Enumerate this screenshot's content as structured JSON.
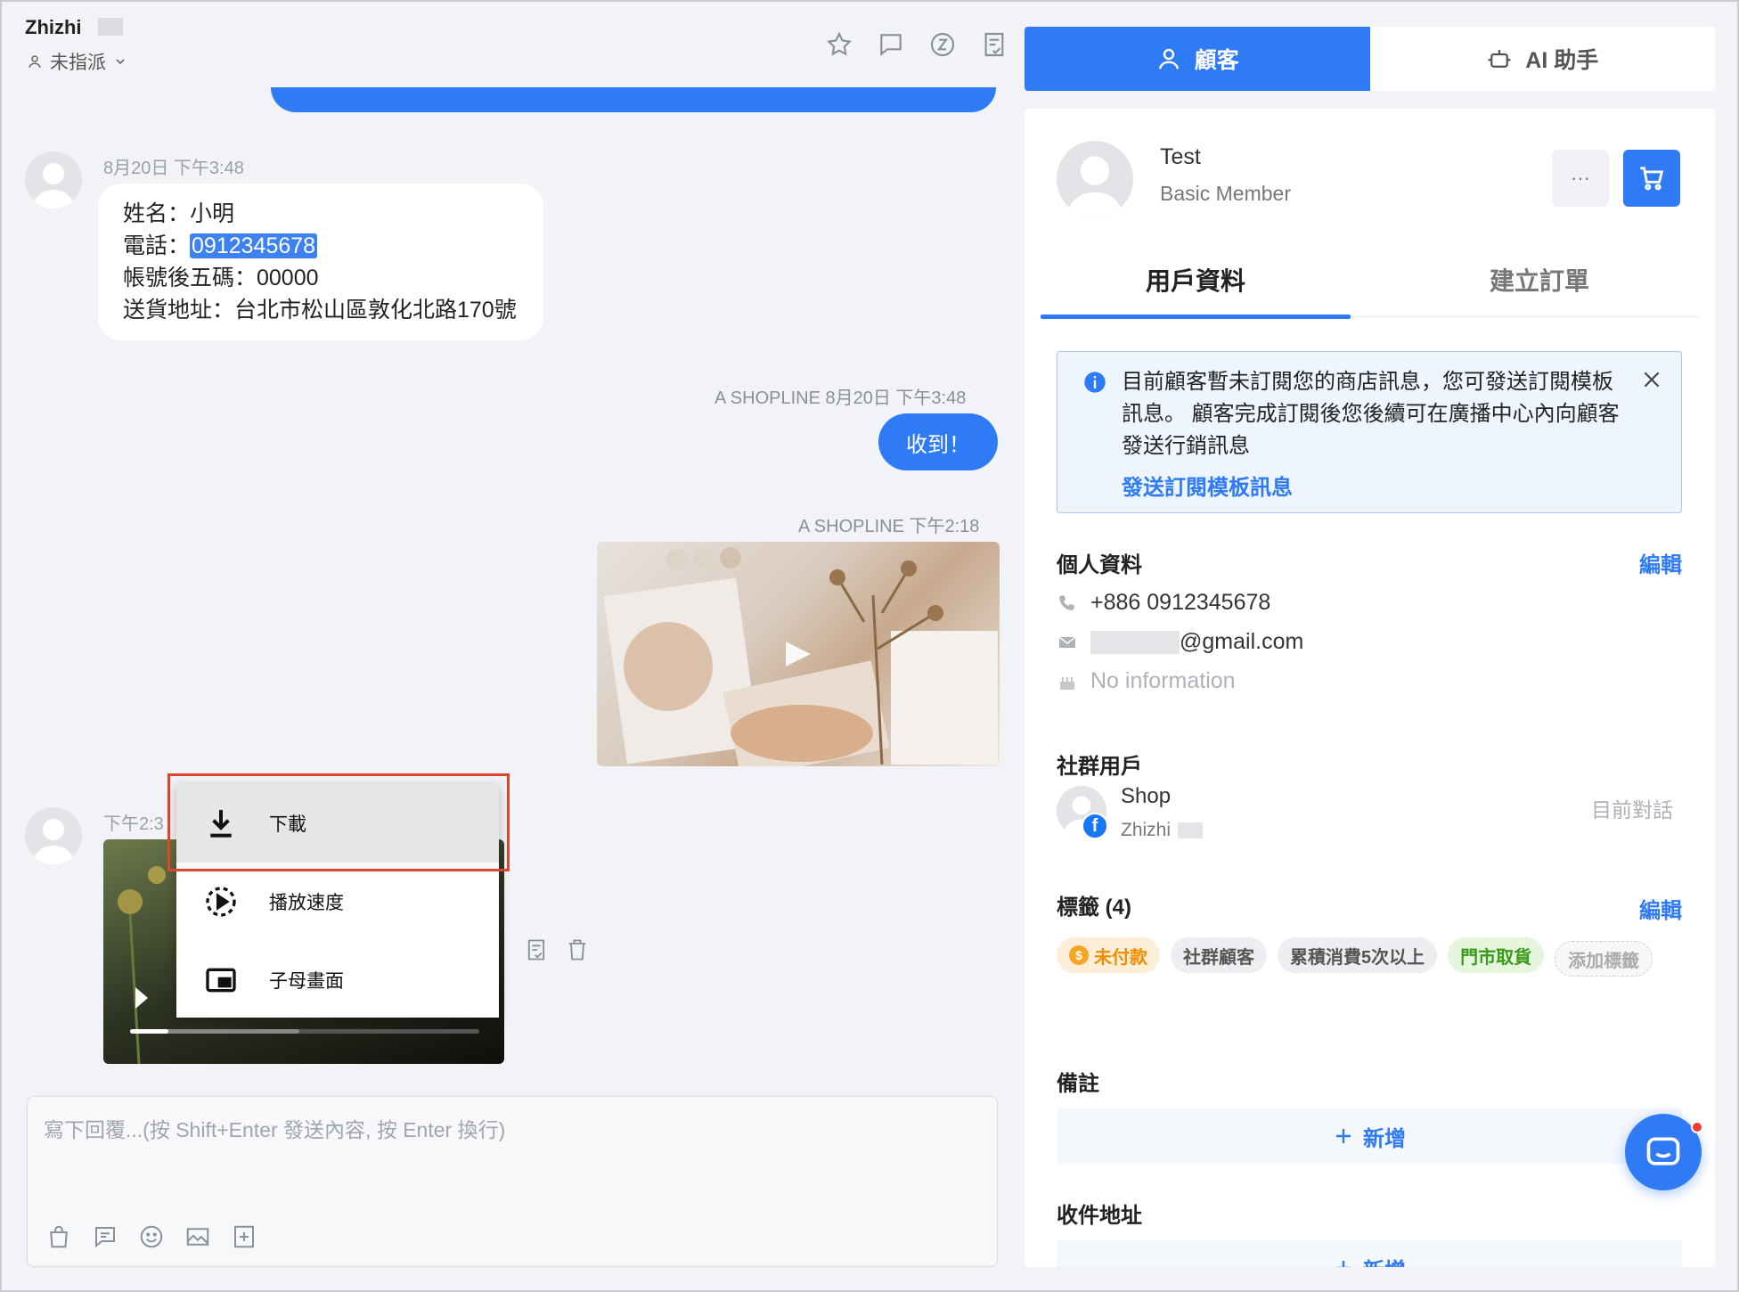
{
  "header": {
    "contact_name": "Zhizhi",
    "assignee": "未指派"
  },
  "messages": {
    "m1_time": "8月20日 下午3:48",
    "m1_name_line": "姓名：小明",
    "m1_phone_label": "電話：",
    "m1_phone_value": "0912345678",
    "m1_account_line": "帳號後五碼：00000",
    "m1_address_line": "送貨地址：台北市松山區敦化北路170號",
    "m2_meta": "A SHOPLINE 8月20日 下午3:48",
    "m2_text": "收到！",
    "m3_meta": "A SHOPLINE 下午2:18",
    "m4_time": "下午2:3",
    "video_progress_percent": 11
  },
  "context_menu": {
    "download": "下載",
    "speed": "播放速度",
    "pip": "子母畫面"
  },
  "composer": {
    "placeholder": "寫下回覆...(按 Shift+Enter 發送內容, 按 Enter 換行)"
  },
  "right_tabs": {
    "customer": "顧客",
    "ai": "AI 助手"
  },
  "profile": {
    "name": "Test",
    "member": "Basic Member",
    "more": "···"
  },
  "subtabs": {
    "info": "用戶資料",
    "order": "建立訂單"
  },
  "notice": {
    "text": "目前顧客暫未訂閱您的商店訊息，您可發送訂閱模板訊息。 顧客完成訂閱後您後續可在廣播中心內向顧客發送行銷訊息",
    "link": "發送訂閱模板訊息"
  },
  "personal": {
    "title": "個人資料",
    "edit": "編輯",
    "phone": "+886 0912345678",
    "email_suffix": "@gmail.com",
    "birthday": "No information"
  },
  "social": {
    "title": "社群用戶",
    "name": "Shop",
    "sub": "Zhizhi",
    "current": "目前對話"
  },
  "tags": {
    "title": "標籤 (4)",
    "edit": "編輯",
    "items": [
      "未付款",
      "社群顧客",
      "累積消費5次以上",
      "門市取貨"
    ],
    "add": "添加標籤"
  },
  "notes": {
    "title": "備註",
    "add": "新增"
  },
  "address": {
    "title": "收件地址",
    "add": "新增"
  },
  "colors": {
    "accent": "#2f7bf5",
    "highlight_box": "#e0442c"
  }
}
